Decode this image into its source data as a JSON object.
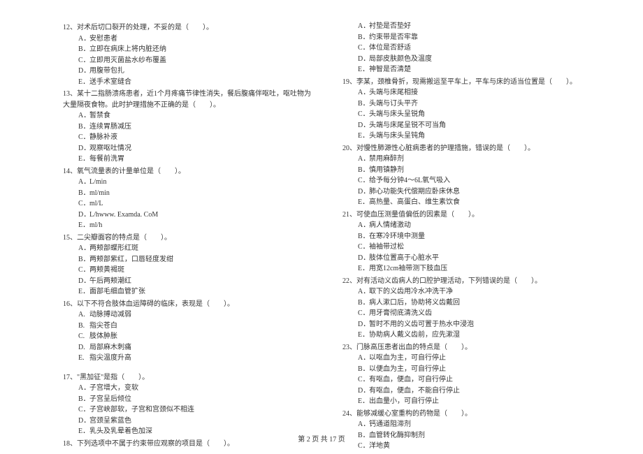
{
  "left": [
    {
      "q": "12、对术后切口裂开的处理，不妥的是（　　）。",
      "opts": [
        "安慰患者",
        "立即在病床上将内脏还纳",
        "立即用灭菌盐水纱布覆盖",
        "用腹带包扎",
        "送手术室缝合"
      ]
    },
    {
      "q": "13、某十二指肠溃疡患者，近1个月疼痛节律性消失，餐后腹痛伴呕吐，呕吐物为大量隔夜食物。此时护理措施不正确的是（　　）。",
      "opts": [
        "暂禁食",
        "连续胃肠减压",
        "静脉补液",
        "观察呕吐情况",
        "每餐前洗胃"
      ]
    },
    {
      "q": "14、氧气流量表的计量单位是（　　）。",
      "opts": [
        "L/min",
        "ml/min",
        "ml/L",
        "L/hwww. Examda. CoM",
        "ml/h"
      ]
    },
    {
      "q": "15、二尖瓣面容的特点是（　　）。",
      "opts": [
        "两颊部蝶形红斑",
        "两颊部紫红，口唇轻度发绀",
        "两颊黄褐斑",
        "午后两颊潮红",
        "面部毛细血管扩张"
      ]
    },
    {
      "q": "16、以下不符合肢体血运障碍的临床，表现是（　　）。",
      "opts": [
        "动脉搏动减弱",
        "指尖苍白",
        "肢体肿胀",
        "局部麻木刺痛",
        "指尖温度升高"
      ],
      "labels": [
        "A.",
        "B.",
        "C.",
        "D.",
        "E."
      ],
      "short": [
        false,
        false,
        false,
        true,
        false
      ]
    },
    {
      "q": "",
      "opts": []
    },
    {
      "q": "17、\"黑加征\"是指（　　）。",
      "opts": [
        "子宫增大，变软",
        "子宫呈后倾位",
        "子宫峡部软，子宫和宫颈似不相连",
        "宫颈呈紫蓝色",
        "乳头及乳晕着色加深"
      ]
    },
    {
      "q": "18、下列选项中不属于约束带应观察的项目是（　　）。",
      "opts": []
    }
  ],
  "right": [
    {
      "q": "",
      "opts": [
        "衬垫是否垫好",
        "约束带是否牢靠",
        "体位是否舒适",
        "局部皮肤颜色及温度",
        "神智是否清楚"
      ]
    },
    {
      "q": "19、李某，颈椎骨折，现需搬运至平车上，平车与床的适当位置是（　　）。",
      "opts": [
        "头端与床尾相接",
        "头端与订头平齐",
        "头端与床头呈锐角",
        "头端与床尾呈锐不可当角",
        "头端与床头呈钝角"
      ]
    },
    {
      "q": "20、对慢性肺源性心脏病患者的护理措施，错误的是（　　）。",
      "opts": [
        "禁用麻醉剂",
        "慎用镇静剂",
        "给予每分钟4～6L氧气吸入",
        "肺心功能失代偿期应卧床休息",
        "高热量、高蛋白、维生素饮食"
      ]
    },
    {
      "q": "21、可使血压测量值偏低的因素是（　　）。",
      "opts": [
        "病人情绪激动",
        "在寒冷环境中测量",
        "袖袖带过松",
        "肢体位置高于心脏水平",
        "用宽12cm袖带测下肢血压"
      ]
    },
    {
      "q": "22、对有活动义齿病人的口腔护理活动，下列错误的是（　　）。",
      "opts": [
        "取下的义齿用冷水冲洗干净",
        "病人漱口后，协助将义齿戴回",
        "用牙膏彻底清洗义齿",
        "暂时不用的义齿可置于热水中浸泡",
        "协助病人戴义齿前，应先漱湿"
      ]
    },
    {
      "q": "23、门脉高压患者出血的特点是（　　）。",
      "opts": [
        "以呕血为主，可自行停止",
        "以便血为主，可自行停止",
        "有呕血，便血，可自行停止",
        "有呕血，便血，不能自行停止",
        "出血量小，可自行停止"
      ]
    },
    {
      "q": "24、能够减缓心室重构的药物是（　　）。",
      "opts": [
        "钙通道阻滞剂",
        "血管转化酶抑制剂",
        "洋地黄"
      ]
    }
  ],
  "footer": "第 2 页 共 17 页",
  "optLabels": [
    "A．",
    "B．",
    "C．",
    "D．",
    "E．"
  ]
}
